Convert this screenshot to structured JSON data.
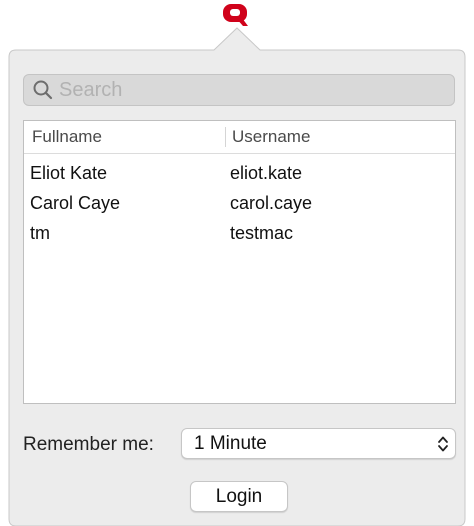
{
  "menubar": {
    "app_icon": "q-logo-icon",
    "app_icon_color": "#d0021b"
  },
  "search": {
    "placeholder": "Search",
    "value": "",
    "icon": "search-icon"
  },
  "table": {
    "columns": [
      "Fullname",
      "Username"
    ],
    "rows": [
      {
        "fullname": "Eliot Kate",
        "username": "eliot.kate"
      },
      {
        "fullname": "Carol Caye",
        "username": "carol.caye"
      },
      {
        "fullname": "tm",
        "username": "testmac"
      }
    ]
  },
  "remember": {
    "label": "Remember me:",
    "selected": "1 Minute",
    "icon": "up-down-chevron-icon"
  },
  "login": {
    "label": "Login"
  },
  "colors": {
    "panel_background": "#ececec",
    "panel_border": "#c8c8c8",
    "accent": "#d0021b"
  }
}
